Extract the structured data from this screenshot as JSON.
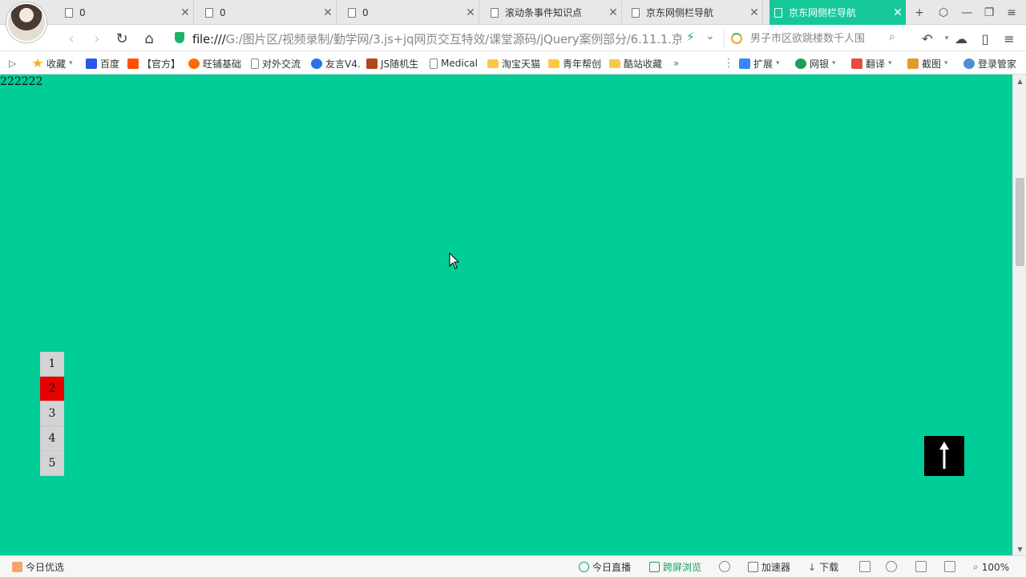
{
  "tabs": [
    {
      "label": "0",
      "close": "✕"
    },
    {
      "label": "0",
      "close": "✕"
    },
    {
      "label": "0",
      "close": "✕"
    },
    {
      "label": "滚动条事件知识点",
      "close": "✕"
    },
    {
      "label": "京东网侧栏导航",
      "close": "✕"
    },
    {
      "label": "京东网侧栏导航",
      "close": "✕"
    }
  ],
  "window_controls": {
    "new_tab": "+",
    "restore_alt": "⬡",
    "minimize": "—",
    "maximize": "❐",
    "menu": "≡"
  },
  "address": {
    "url_prefix": "file:///",
    "url_rest": "G:/图片区/视频录制/勤学网/3.js+jq网页交互特效/课堂源码/jQuery案例部分/6.11.1.京",
    "search_placeholder": "男子市区欲跳楼数千人围"
  },
  "nav": {
    "back": "‹",
    "forward": "›",
    "reload": "↻",
    "home": "⌂",
    "dropdown": "⌄",
    "undo": "↶"
  },
  "bookmarks": [
    {
      "label": "收藏",
      "icon": "star"
    },
    {
      "label": "百度",
      "icon": "baidu"
    },
    {
      "label": "【官方】",
      "icon": "tao"
    },
    {
      "label": "旺铺基础",
      "icon": "wang"
    },
    {
      "label": "对外交流",
      "icon": "page"
    },
    {
      "label": "友言V4.",
      "icon": "you"
    },
    {
      "label": "JS随机生",
      "icon": "js"
    },
    {
      "label": "Medical",
      "icon": "page"
    },
    {
      "label": "淘宝天猫",
      "icon": "folder"
    },
    {
      "label": "青年帮创",
      "icon": "folder"
    },
    {
      "label": "酷站收藏",
      "icon": "folder"
    }
  ],
  "bookmarks_more": "»",
  "bookmarks_menu": "⋮",
  "toolbar_right": [
    {
      "label": "扩展",
      "icon": "ext"
    },
    {
      "label": "网银",
      "icon": "bank"
    },
    {
      "label": "翻译",
      "icon": "trans"
    },
    {
      "label": "截图",
      "icon": "shot"
    },
    {
      "label": "登录管家",
      "icon": "login"
    }
  ],
  "page": {
    "text": "222222",
    "side_nav": [
      "1",
      "2",
      "3",
      "4",
      "5"
    ],
    "side_nav_current": "2",
    "back_to_top": "↑"
  },
  "colors": {
    "page_bg": "#00cd98",
    "active_tab": "#16c79a",
    "current_nav": "#e60000",
    "nav_item": "#d3d3d3",
    "to_top": "#000000"
  },
  "statusbar": {
    "left": "今日优选",
    "live": "今日直播",
    "cross_screen": "跨屏浏览",
    "accelerator": "加速器",
    "download": "下载",
    "zoom": "100%"
  }
}
